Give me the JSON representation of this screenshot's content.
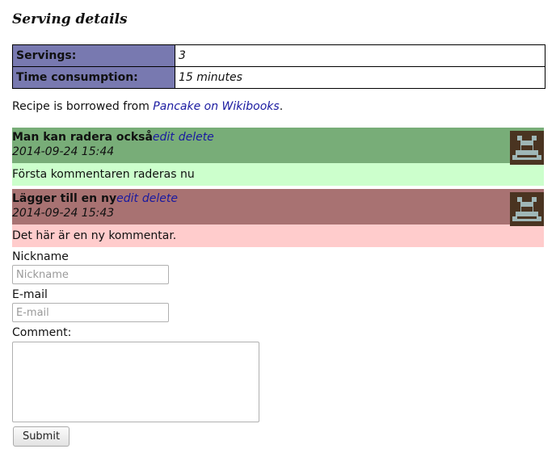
{
  "section": {
    "title": "Serving details"
  },
  "details": [
    {
      "label": "Servings:",
      "value": "3"
    },
    {
      "label": "Time consumption:",
      "value": "15 minutes"
    }
  ],
  "source": {
    "prefix": "Recipe is borrowed from ",
    "link_text": "Pancake on Wikibooks",
    "suffix": "."
  },
  "comments": [
    {
      "title": "Man kan radera också",
      "edit_label": "edit",
      "delete_label": "delete",
      "date": "2014-09-24 15:44",
      "body": "Första kommentaren raderas nu",
      "head_color": "#78ad78",
      "body_color": "#ccffcc",
      "avatar": "identicon"
    },
    {
      "title": "Lägger till en ny",
      "edit_label": "edit",
      "delete_label": "delete",
      "date": "2014-09-24 15:43",
      "body": "Det här är en ny kommentar.",
      "head_color": "#a87272",
      "body_color": "#ffcccc",
      "avatar": "identicon"
    }
  ],
  "form": {
    "nickname_label": "Nickname",
    "nickname_placeholder": "Nickname",
    "email_label": "E-mail",
    "email_placeholder": "E-mail",
    "comment_label": "Comment:",
    "submit_label": "Submit"
  }
}
